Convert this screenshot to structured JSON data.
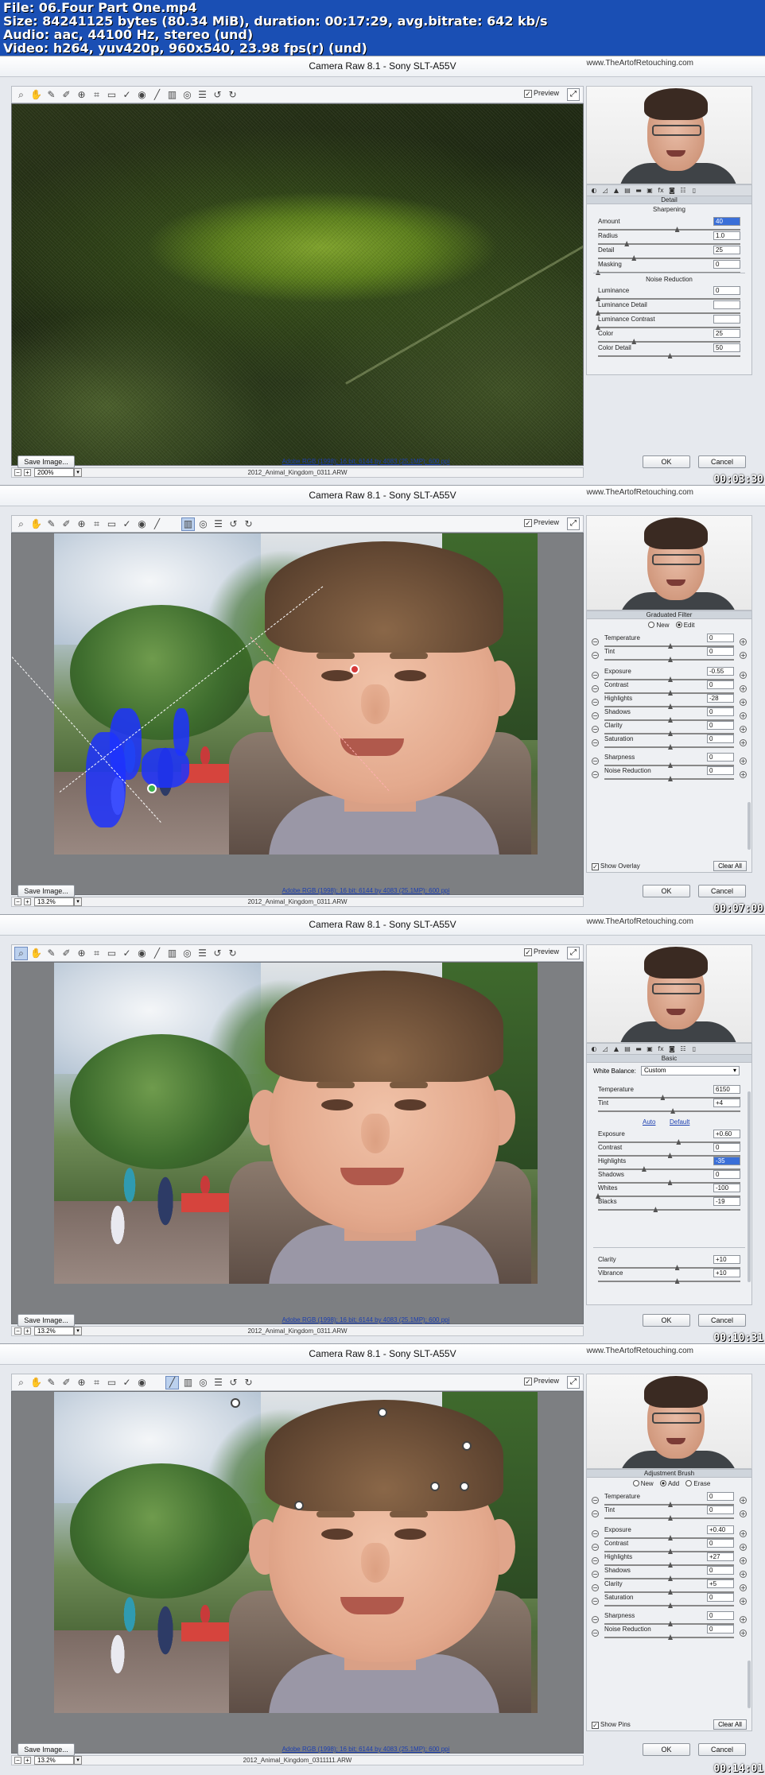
{
  "info": {
    "file": "File: 06.Four Part One.mp4",
    "size": "Size: 84241125 bytes (80.34 MiB), duration: 00:17:29, avg.bitrate: 642 kb/s",
    "audio": "Audio: aac, 44100 Hz, stereo (und)",
    "video": "Video: h264, yuv420p, 960x540, 23.98 fps(r) (und)"
  },
  "common": {
    "title": "Camera Raw 8.1  -  Sony SLT-A55V",
    "brand": "www.TheArtofRetouching.com",
    "preview": "Preview",
    "save_image": "Save Image...",
    "workflow": "Adobe RGB (1998); 16 bit; 6144 by 4083 (25.1MP); 600 ppi",
    "ok": "OK",
    "cancel": "Cancel",
    "zoom": "13.2%"
  },
  "frames": [
    {
      "timestamp": "00:03:30",
      "zoom": "200%",
      "filename": "2012_Animal_Kingdom_0311.ARW",
      "panel": {
        "header": "Detail",
        "sharpening_title": "Sharpening",
        "sharpening": [
          {
            "label": "Amount",
            "value": "40",
            "pos": 0.55,
            "highlight": true
          },
          {
            "label": "Radius",
            "value": "1.0",
            "pos": 0.2
          },
          {
            "label": "Detail",
            "value": "25",
            "pos": 0.25
          },
          {
            "label": "Masking",
            "value": "0",
            "pos": 0.0
          }
        ],
        "nr_title": "Noise Reduction",
        "noise": [
          {
            "label": "Luminance",
            "value": "0",
            "pos": 0.0
          },
          {
            "label": "Luminance Detail",
            "value": "",
            "pos": 0.0
          },
          {
            "label": "Luminance Contrast",
            "value": "",
            "pos": 0.0
          },
          {
            "label": "Color",
            "value": "25",
            "pos": 0.25
          },
          {
            "label": "Color Detail",
            "value": "50",
            "pos": 0.5
          }
        ]
      }
    },
    {
      "timestamp": "00:07:00",
      "filename": "2012_Animal_Kingdom_0311.ARW",
      "panel": {
        "header": "Graduated Filter",
        "radio_new": "New",
        "radio_edit": "Edit",
        "sliders": [
          {
            "label": "Temperature",
            "value": "0"
          },
          {
            "label": "Tint",
            "value": "0"
          },
          {
            "label": "Exposure",
            "value": "-0.55"
          },
          {
            "label": "Contrast",
            "value": "0"
          },
          {
            "label": "Highlights",
            "value": "-28"
          },
          {
            "label": "Shadows",
            "value": "0"
          },
          {
            "label": "Clarity",
            "value": "0"
          },
          {
            "label": "Saturation",
            "value": "0"
          },
          {
            "label": "Sharpness",
            "value": "0"
          },
          {
            "label": "Noise Reduction",
            "value": "0"
          }
        ],
        "overlay": "Show Overlay",
        "clear_all": "Clear All"
      }
    },
    {
      "timestamp": "00:10:31",
      "filename": "2012_Animal_Kingdom_0311.ARW",
      "panel": {
        "header": "Basic",
        "wb_label": "White Balance:",
        "wb_value": "Custom",
        "top": [
          {
            "label": "Temperature",
            "value": "6150",
            "pos": 0.45
          },
          {
            "label": "Tint",
            "value": "+4",
            "pos": 0.52
          }
        ],
        "auto": "Auto",
        "default": "Default",
        "tone": [
          {
            "label": "Exposure",
            "value": "+0.60",
            "pos": 0.56
          },
          {
            "label": "Contrast",
            "value": "0",
            "pos": 0.5
          },
          {
            "label": "Highlights",
            "value": "-35",
            "pos": 0.32,
            "highlight": true
          },
          {
            "label": "Shadows",
            "value": "0",
            "pos": 0.5
          },
          {
            "label": "Whites",
            "value": "-100",
            "pos": 0.0
          },
          {
            "label": "Blacks",
            "value": "-19",
            "pos": 0.4
          }
        ],
        "presence": [
          {
            "label": "Clarity",
            "value": "+10",
            "pos": 0.55
          },
          {
            "label": "Vibrance",
            "value": "+10",
            "pos": 0.55
          }
        ]
      }
    },
    {
      "timestamp": "00:14:01",
      "filename": "2012_Animal_Kingdom_0311111.ARW",
      "panel": {
        "header": "Adjustment Brush",
        "radio_new": "New",
        "radio_add": "Add",
        "radio_erase": "Erase",
        "sliders": [
          {
            "label": "Temperature",
            "value": "0"
          },
          {
            "label": "Tint",
            "value": "0"
          },
          {
            "label": "Exposure",
            "value": "+0.40"
          },
          {
            "label": "Contrast",
            "value": "0"
          },
          {
            "label": "Highlights",
            "value": "+27"
          },
          {
            "label": "Shadows",
            "value": "0"
          },
          {
            "label": "Clarity",
            "value": "+5"
          },
          {
            "label": "Saturation",
            "value": "0"
          },
          {
            "label": "Sharpness",
            "value": "0"
          },
          {
            "label": "Noise Reduction",
            "value": "0"
          }
        ],
        "show_pins": "Show Pins",
        "clear_all": "Clear All"
      }
    }
  ]
}
